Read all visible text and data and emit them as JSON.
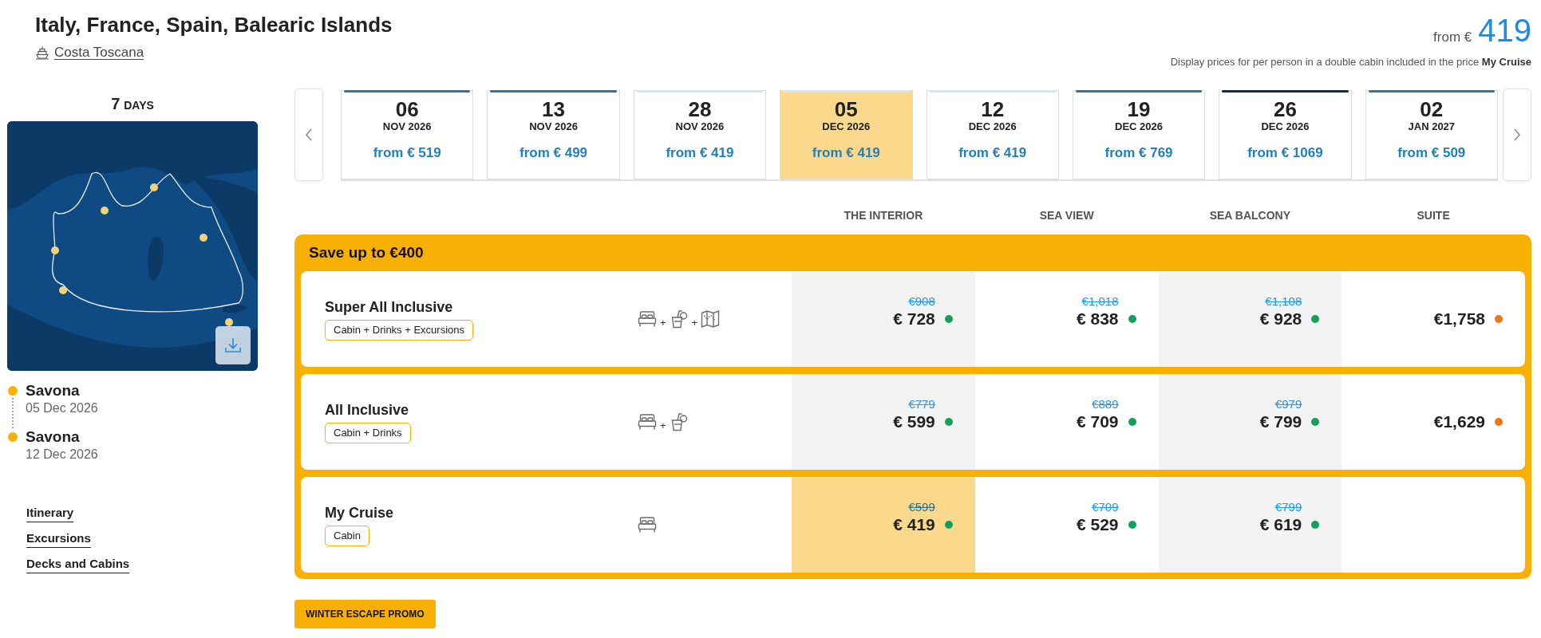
{
  "header": {
    "title": "Italy, France, Spain, Balearic Islands",
    "ship": "Costa Toscana",
    "from_label": "from €",
    "from_price": "419",
    "note": "Display prices for per person in a double cabin included in the price **My Cruise**"
  },
  "sidebar": {
    "duration": {
      "number": "7",
      "unit": "DAYS"
    },
    "stops": [
      {
        "port": "Savona",
        "date": "05 Dec 2026"
      },
      {
        "port": "Savona",
        "date": "12 Dec 2026"
      }
    ],
    "links": [
      "Itinerary",
      "Excursions",
      "Decks and Cabins"
    ]
  },
  "dates": [
    {
      "day": "06",
      "month": "NOV 2026",
      "price": "from € 519",
      "color": "#3a6ea5",
      "selected": false
    },
    {
      "day": "13",
      "month": "NOV 2026",
      "price": "from € 499",
      "color": "#3a6ea5",
      "selected": false
    },
    {
      "day": "28",
      "month": "NOV 2026",
      "price": "from € 419",
      "color": "#cfe6f6",
      "selected": false
    },
    {
      "day": "05",
      "month": "DEC 2026",
      "price": "from € 419",
      "color": "#cfe6f6",
      "selected": true
    },
    {
      "day": "12",
      "month": "DEC 2026",
      "price": "from € 419",
      "color": "#cfe6f6",
      "selected": false
    },
    {
      "day": "19",
      "month": "DEC 2026",
      "price": "from € 769",
      "color": "#3a6ea5",
      "selected": false
    },
    {
      "day": "26",
      "month": "DEC 2026",
      "price": "from € 1069",
      "color": "#0f2a44",
      "selected": false
    },
    {
      "day": "02",
      "month": "JAN 2027",
      "price": "from € 509",
      "color": "#3a6ea5",
      "selected": false
    }
  ],
  "cabin_columns": [
    "THE INTERIOR",
    "SEA VIEW",
    "SEA BALCONY",
    "SUITE"
  ],
  "promo": {
    "title": "Save up to €400",
    "packages": [
      {
        "name": "Super All Inclusive",
        "tag": "Cabin + Drinks + Excursions",
        "inclusions": [
          {
            "kind": "cabin"
          },
          {
            "kind": "drinks",
            "prefix": "+"
          },
          {
            "kind": "excursions",
            "prefix": "+"
          }
        ],
        "prices": [
          {
            "old": "€908",
            "price": "€ 728",
            "color": "#12a05c",
            "selected": false
          },
          {
            "old": "€1,018",
            "price": "€ 838",
            "color": "#12a05c",
            "selected": false
          },
          {
            "old": "€1,108",
            "price": "€ 928",
            "color": "#12a05c",
            "selected": false
          },
          {
            "price": "€1,758",
            "color": "#f2760f",
            "selected": false
          }
        ]
      },
      {
        "name": "All Inclusive",
        "tag": "Cabin + Drinks",
        "inclusions": [
          {
            "kind": "cabin"
          },
          {
            "kind": "drinks",
            "prefix": "+"
          }
        ],
        "prices": [
          {
            "old": "€779",
            "price": "€ 599",
            "color": "#12a05c",
            "selected": false
          },
          {
            "old": "€889",
            "price": "€ 709",
            "color": "#12a05c",
            "selected": false
          },
          {
            "old": "€979",
            "price": "€ 799",
            "color": "#12a05c",
            "selected": false
          },
          {
            "price": "€1,629",
            "color": "#f2760f",
            "selected": false
          }
        ]
      },
      {
        "name": "My Cruise",
        "tag": "Cabin",
        "inclusions": [
          {
            "kind": "cabin"
          }
        ],
        "prices": [
          {
            "old": "€599",
            "price": "€ 419",
            "color": "#12a05c",
            "selected": true
          },
          {
            "old": "€709",
            "price": "€ 529",
            "color": "#12a05c",
            "selected": false
          },
          {
            "old": "€799",
            "price": "€ 619",
            "color": "#12a05c",
            "selected": false
          }
        ]
      }
    ]
  },
  "promo_button": "WINTER ESCAPE PROMO"
}
